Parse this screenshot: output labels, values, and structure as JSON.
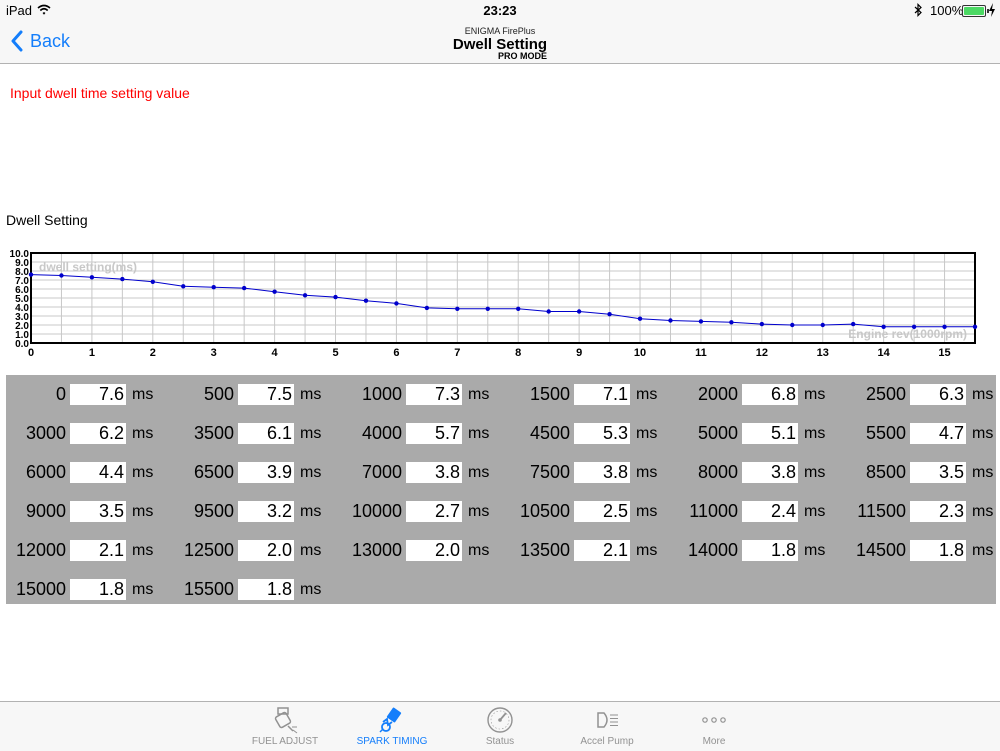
{
  "status_bar": {
    "device": "iPad",
    "time": "23:23",
    "battery": "100%"
  },
  "nav": {
    "back_label": "Back",
    "app_name": "ENIGMA FirePlus",
    "title": "Dwell Setting",
    "mode": "PRO MODE"
  },
  "instruction": "Input dwell time setting value",
  "section_title": "Dwell Setting",
  "chart_data": {
    "type": "line",
    "ylabel": "dwell setting(ms)",
    "xlabel": "Engine rev(1000rpm)",
    "x_ticks": [
      "0",
      "1",
      "2",
      "3",
      "4",
      "5",
      "6",
      "7",
      "8",
      "9",
      "10",
      "11",
      "12",
      "13",
      "14",
      "15"
    ],
    "y_ticks": [
      "0.0",
      "1.0",
      "2.0",
      "3.0",
      "4.0",
      "5.0",
      "6.0",
      "7.0",
      "8.0",
      "9.0",
      "10.0"
    ],
    "xlim": [
      0,
      15.5
    ],
    "ylim": [
      0,
      10
    ],
    "grid": true,
    "series": [
      {
        "x": [
          0,
          0.5,
          1,
          1.5,
          2,
          2.5,
          3,
          3.5,
          4,
          4.5,
          5,
          5.5,
          6,
          6.5,
          7,
          7.5,
          8,
          8.5,
          9,
          9.5,
          10,
          10.5,
          11,
          11.5,
          12,
          12.5,
          13,
          13.5,
          14,
          14.5,
          15,
          15.5
        ],
        "values": [
          7.6,
          7.5,
          7.3,
          7.1,
          6.8,
          6.3,
          6.2,
          6.1,
          5.7,
          5.3,
          5.1,
          4.7,
          4.4,
          3.9,
          3.8,
          3.8,
          3.8,
          3.5,
          3.5,
          3.2,
          2.7,
          2.5,
          2.4,
          2.3,
          2.1,
          2.0,
          2.0,
          2.1,
          1.8,
          1.8,
          1.8,
          1.8
        ]
      }
    ]
  },
  "dwell_table": {
    "unit": "ms",
    "rows": [
      [
        {
          "rpm": "0",
          "value": "7.6"
        },
        {
          "rpm": "500",
          "value": "7.5"
        },
        {
          "rpm": "1000",
          "value": "7.3"
        },
        {
          "rpm": "1500",
          "value": "7.1"
        },
        {
          "rpm": "2000",
          "value": "6.8"
        },
        {
          "rpm": "2500",
          "value": "6.3"
        }
      ],
      [
        {
          "rpm": "3000",
          "value": "6.2"
        },
        {
          "rpm": "3500",
          "value": "6.1"
        },
        {
          "rpm": "4000",
          "value": "5.7"
        },
        {
          "rpm": "4500",
          "value": "5.3"
        },
        {
          "rpm": "5000",
          "value": "5.1"
        },
        {
          "rpm": "5500",
          "value": "4.7"
        }
      ],
      [
        {
          "rpm": "6000",
          "value": "4.4"
        },
        {
          "rpm": "6500",
          "value": "3.9"
        },
        {
          "rpm": "7000",
          "value": "3.8"
        },
        {
          "rpm": "7500",
          "value": "3.8"
        },
        {
          "rpm": "8000",
          "value": "3.8"
        },
        {
          "rpm": "8500",
          "value": "3.5"
        }
      ],
      [
        {
          "rpm": "9000",
          "value": "3.5"
        },
        {
          "rpm": "9500",
          "value": "3.2"
        },
        {
          "rpm": "10000",
          "value": "2.7"
        },
        {
          "rpm": "10500",
          "value": "2.5"
        },
        {
          "rpm": "11000",
          "value": "2.4"
        },
        {
          "rpm": "11500",
          "value": "2.3"
        }
      ],
      [
        {
          "rpm": "12000",
          "value": "2.1"
        },
        {
          "rpm": "12500",
          "value": "2.0"
        },
        {
          "rpm": "13000",
          "value": "2.0"
        },
        {
          "rpm": "13500",
          "value": "2.1"
        },
        {
          "rpm": "14000",
          "value": "1.8"
        },
        {
          "rpm": "14500",
          "value": "1.8"
        }
      ],
      [
        {
          "rpm": "15000",
          "value": "1.8"
        },
        {
          "rpm": "15500",
          "value": "1.8"
        }
      ]
    ]
  },
  "tabs": [
    {
      "label": "FUEL ADJUST",
      "icon": "fuel-injector-icon",
      "active": false
    },
    {
      "label": "SPARK TIMING",
      "icon": "spark-plug-icon",
      "active": true
    },
    {
      "label": "Status",
      "icon": "gauge-icon",
      "active": false
    },
    {
      "label": "Accel Pump",
      "icon": "headlight-icon",
      "active": false
    },
    {
      "label": "More",
      "icon": "more-dots-icon",
      "active": false
    }
  ],
  "colors": {
    "accent": "#147efb",
    "instruction": "#ff0000",
    "line": "#0000cc",
    "panel": "#aaaaaa",
    "inactive_tab": "#929292"
  }
}
